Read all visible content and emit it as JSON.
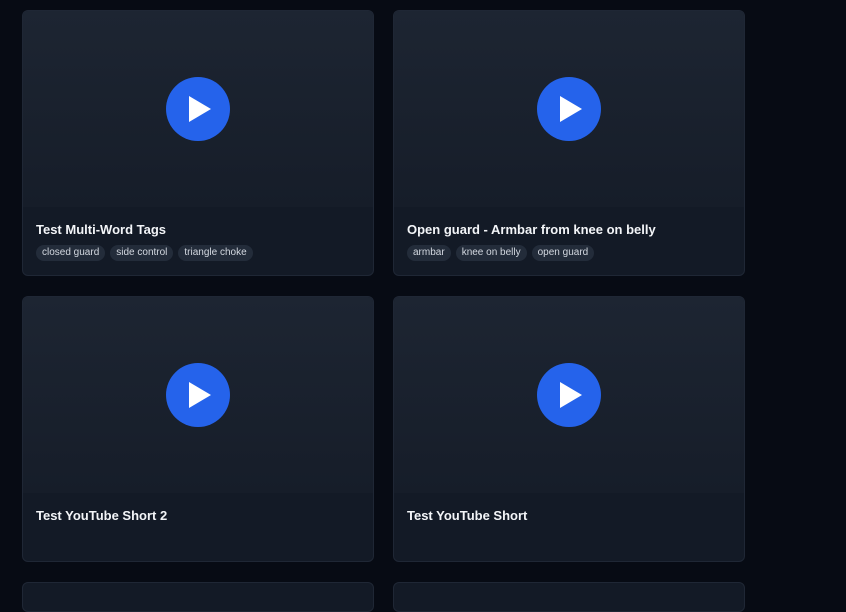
{
  "videos": [
    {
      "title": "Test Multi-Word Tags",
      "tags": [
        "closed guard",
        "side control",
        "triangle choke"
      ]
    },
    {
      "title": "Open guard - Armbar from knee on belly",
      "tags": [
        "armbar",
        "knee on belly",
        "open guard"
      ]
    },
    {
      "title": "Test YouTube Short 2",
      "tags": []
    },
    {
      "title": "Test YouTube Short",
      "tags": []
    }
  ],
  "icons": {
    "play": "play-icon"
  },
  "colors": {
    "accent": "#2563eb",
    "background": "#070b14",
    "card": "#131a26"
  }
}
